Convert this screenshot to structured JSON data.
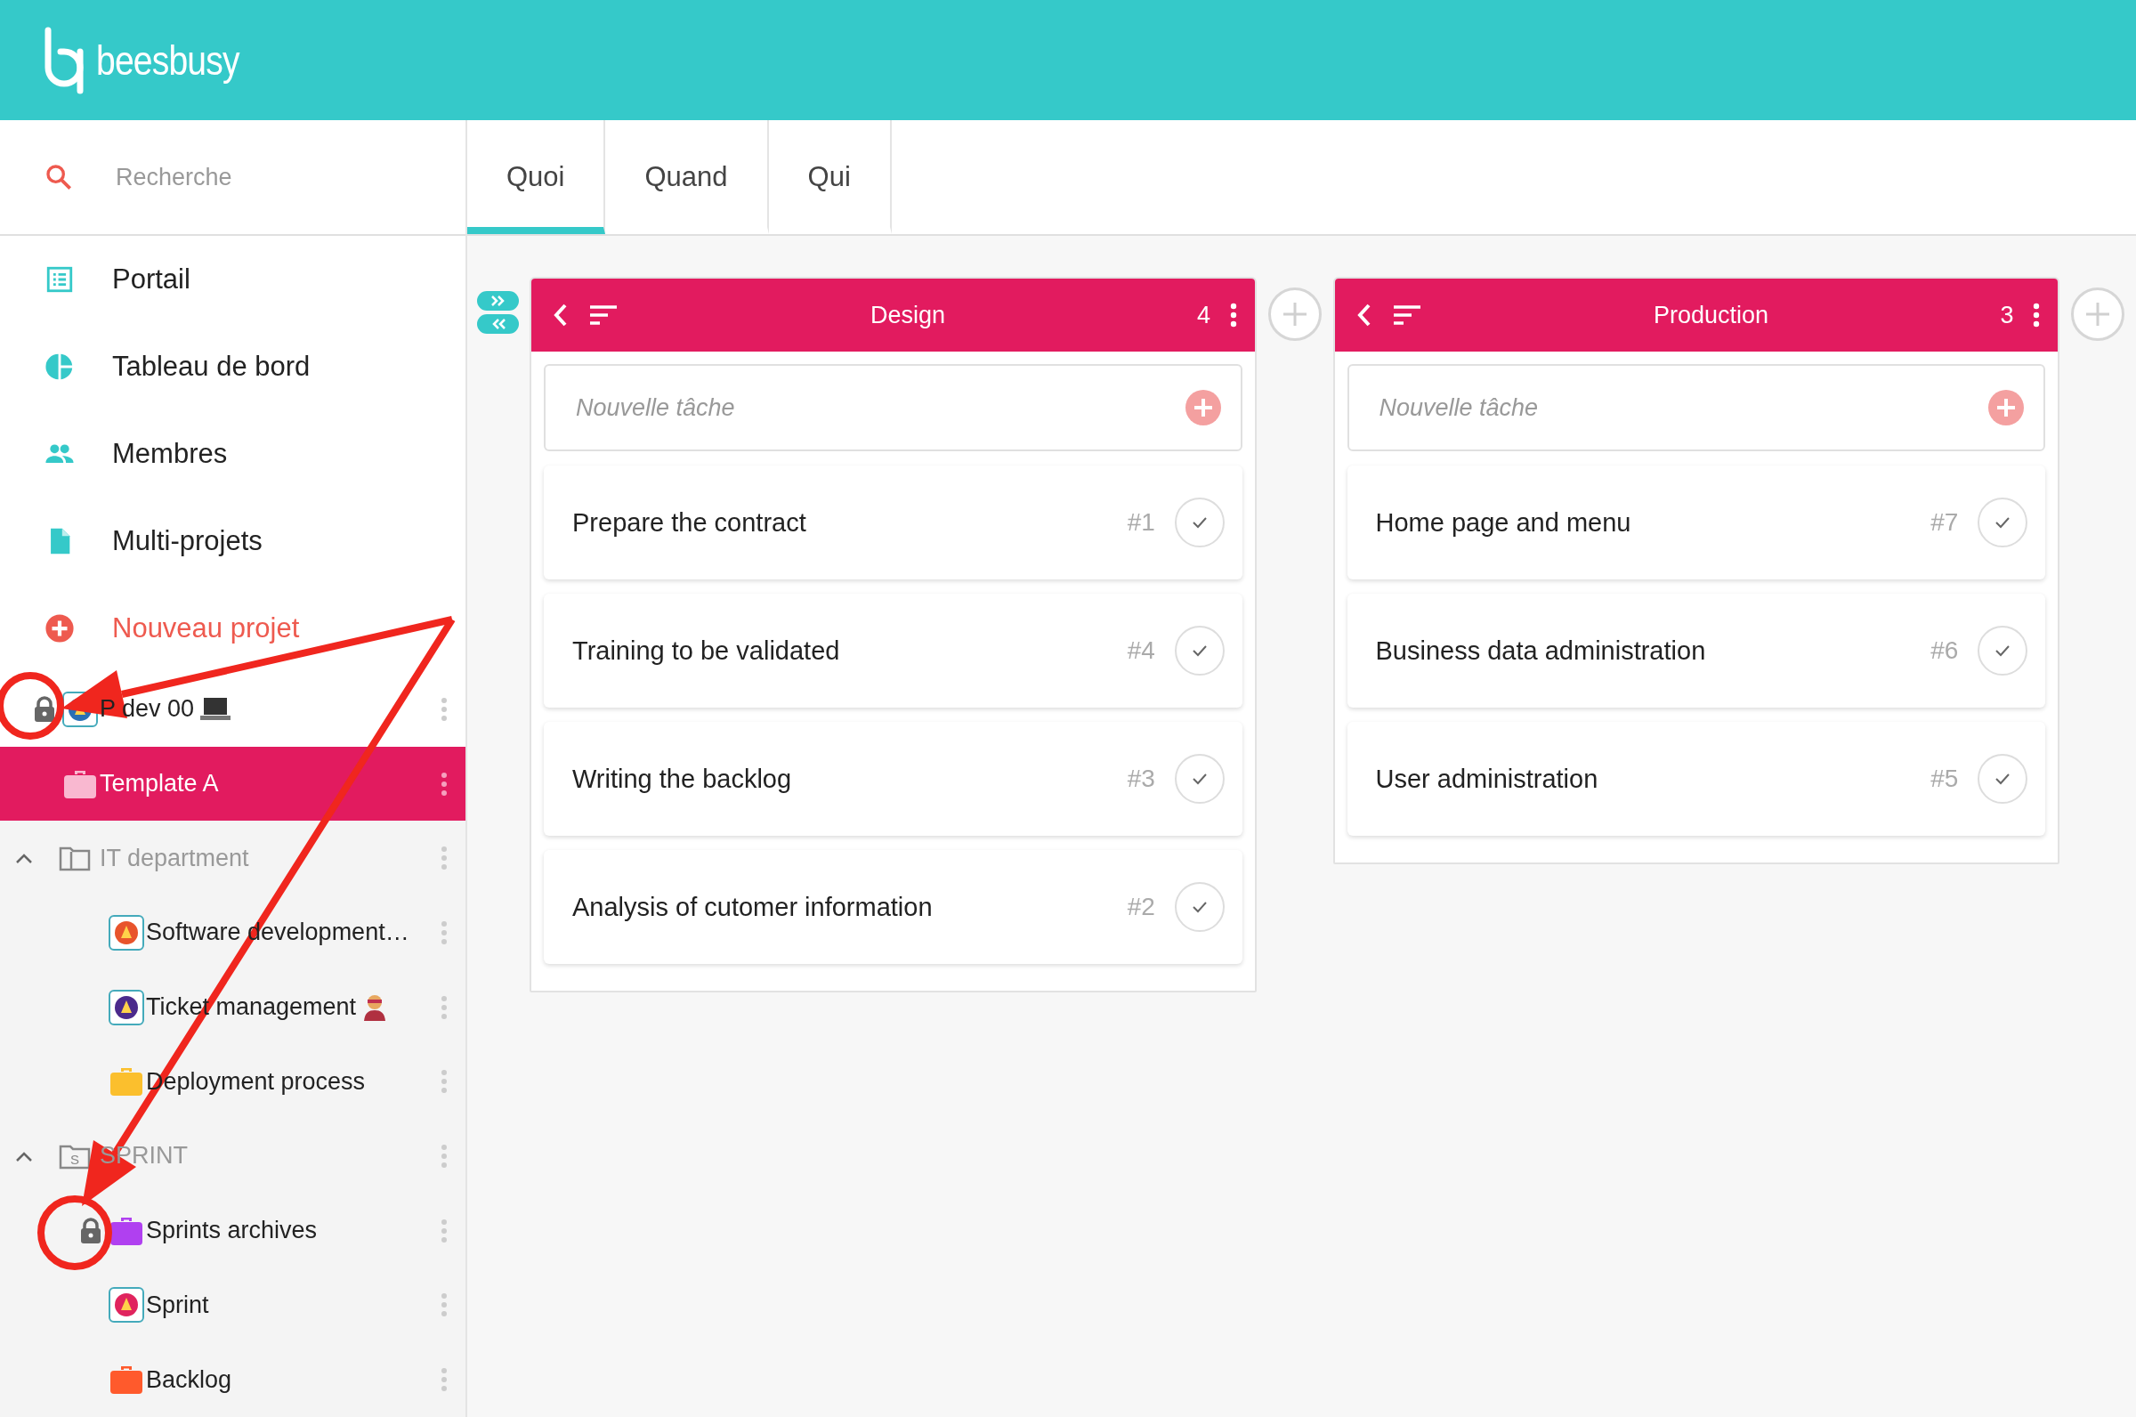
{
  "app": {
    "logo_text": "beesbusy"
  },
  "search": {
    "placeholder": "Recherche"
  },
  "tabs": [
    {
      "label": "Quoi",
      "selected": true
    },
    {
      "label": "Quand",
      "selected": false
    },
    {
      "label": "Qui",
      "selected": false
    }
  ],
  "nav": [
    {
      "label": "Portail",
      "kind": "list"
    },
    {
      "label": "Tableau de bord",
      "kind": "chart"
    },
    {
      "label": "Membres",
      "kind": "people"
    },
    {
      "label": "Multi-projets",
      "kind": "document"
    },
    {
      "label": "Nouveau projet",
      "kind": "new"
    }
  ],
  "projects": [
    {
      "kind": "logo",
      "label": "P dev 00",
      "color": "#2a6fb5",
      "locked": true,
      "selected": false
    },
    {
      "kind": "briefcase",
      "label": "Template A",
      "color": "#f9b8d0",
      "locked": false,
      "selected": true
    },
    {
      "kind": "folder",
      "label": "IT department",
      "expanded": true,
      "children": [
        {
          "kind": "logo",
          "label": "Software development…",
          "color": "#e8542c",
          "locked": false,
          "selected": false
        },
        {
          "kind": "logo",
          "label": "Ticket management",
          "color": "#4b2a8c",
          "locked": false,
          "selected": false
        },
        {
          "kind": "briefcase",
          "label": "Deployment process",
          "color": "#fbbf2d",
          "locked": false,
          "selected": false
        }
      ]
    },
    {
      "kind": "folder",
      "label": "SPRINT",
      "icon_letter": "S",
      "expanded": true,
      "children": [
        {
          "kind": "briefcase",
          "label": "Sprints archives",
          "color": "#b040f0",
          "locked": true,
          "selected": false
        },
        {
          "kind": "logo",
          "label": "Sprint",
          "color": "#e0245e",
          "locked": false,
          "selected": false
        },
        {
          "kind": "briefcase",
          "label": "Backlog",
          "color": "#ff5a2c",
          "locked": false,
          "selected": false
        }
      ]
    }
  ],
  "columns": [
    {
      "title": "Design",
      "count": "4",
      "new_task_placeholder": "Nouvelle tâche",
      "tasks": [
        {
          "title": "Prepare the contract",
          "number": "#1",
          "done": false
        },
        {
          "title": "Training to be validated",
          "number": "#4",
          "done": false
        },
        {
          "title": "Writing the backlog",
          "number": "#3",
          "done": false
        },
        {
          "title": "Analysis of cutomer information",
          "number": "#2",
          "done": false
        }
      ]
    },
    {
      "title": "Production",
      "count": "3",
      "new_task_placeholder": "Nouvelle tâche",
      "tasks": [
        {
          "title": "Home page and menu",
          "number": "#7",
          "done": false
        },
        {
          "title": "Business data administration",
          "number": "#6",
          "done": false
        },
        {
          "title": "User administration",
          "number": "#5",
          "done": false
        }
      ]
    }
  ]
}
